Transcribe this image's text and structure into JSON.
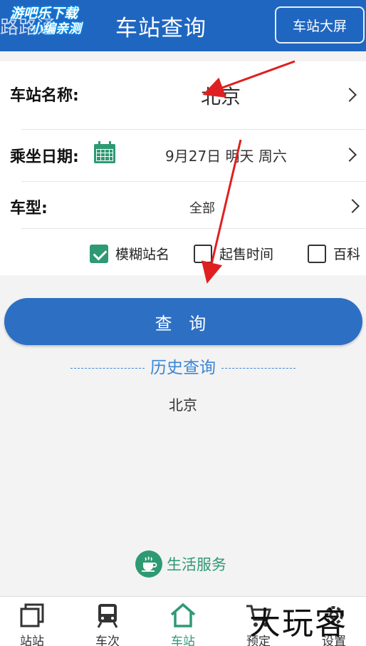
{
  "header": {
    "left_title": "路路通",
    "watermark_line1": "游吧乐下载",
    "watermark_line2": "小编亲测",
    "title": "车站查询",
    "screen_button": "车站大屏"
  },
  "form": {
    "station": {
      "label": "车站名称:",
      "value": "北京"
    },
    "date": {
      "label": "乘坐日期:",
      "value": "9月27日 明天 周六"
    },
    "type": {
      "label": "车型:",
      "value": "全部"
    },
    "checks": [
      {
        "label": "模糊站名",
        "checked": true
      },
      {
        "label": "起售时间",
        "checked": false
      },
      {
        "label": "百科",
        "checked": false
      }
    ]
  },
  "query_button": "查 询",
  "history": {
    "title": "历史查询",
    "items": [
      "北京"
    ]
  },
  "life_service": "生活服务",
  "tabs": [
    {
      "label": "站站",
      "icon": "copy-icon",
      "active": false
    },
    {
      "label": "车次",
      "icon": "train-icon",
      "active": false
    },
    {
      "label": "车站",
      "icon": "home-icon",
      "active": true
    },
    {
      "label": "预定",
      "icon": "cart-icon",
      "active": false
    },
    {
      "label": "设置",
      "icon": "gear-icon",
      "active": false
    }
  ],
  "brand_watermark": "大玩客",
  "colors": {
    "header_bg": "#1f66c1",
    "accent_green": "#2e9a73",
    "query_button_bg": "#2d6fc3",
    "annotation_red": "#e02020"
  }
}
